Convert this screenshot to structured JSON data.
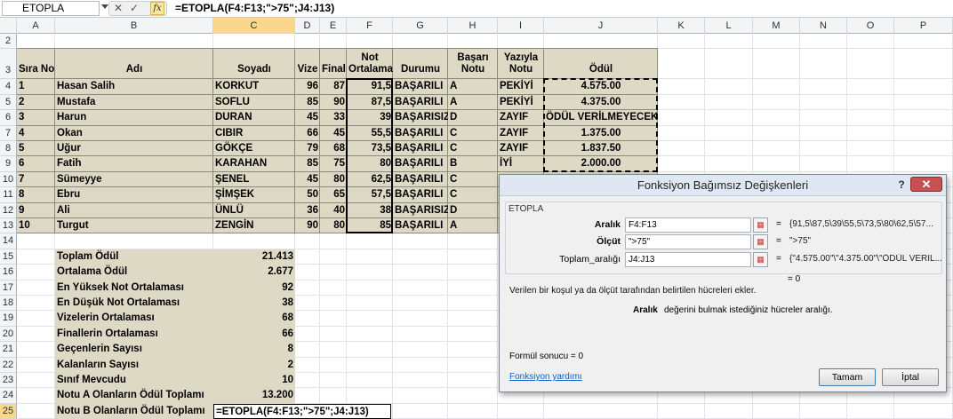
{
  "formula_bar": {
    "name_box": "ETOPLA",
    "cancel_icon": "✕",
    "enter_icon": "✓",
    "fx_label": "fx",
    "formula": "=ETOPLA(F4:F13;\">75\";J4:J13)"
  },
  "columns": [
    "A",
    "B",
    "C",
    "D",
    "E",
    "F",
    "G",
    "H",
    "I",
    "J",
    "K",
    "L",
    "M",
    "N",
    "O",
    "P"
  ],
  "rows": [
    "2",
    "3",
    "4",
    "5",
    "6",
    "7",
    "8",
    "9",
    "10",
    "11",
    "12",
    "13",
    "14",
    "15",
    "16",
    "17",
    "18",
    "19",
    "20",
    "21",
    "22",
    "23",
    "24",
    "25"
  ],
  "header": {
    "sira": "Sıra No",
    "adi": "Adı",
    "soyadi": "Soyadı",
    "vize": "Vize",
    "final": "Final",
    "not1": "Not",
    "not2": "Ortalama",
    "durumu": "Durumu",
    "basari1": "Başarı",
    "basari2": "Notu",
    "yazi1": "Yazıyla",
    "yazi2": "Notu",
    "odul": "Ödül"
  },
  "students": [
    {
      "no": "1",
      "adi": "Hasan Salih",
      "soyadi": "KORKUT",
      "vize": "96",
      "final": "87",
      "ort": "91,5",
      "durum": "BAŞARILI",
      "harf": "A",
      "yazi": "PEKİYİ",
      "odul": "4.575.00"
    },
    {
      "no": "2",
      "adi": "Mustafa",
      "soyadi": "SOFLU",
      "vize": "85",
      "final": "90",
      "ort": "87,5",
      "durum": "BAŞARILI",
      "harf": "A",
      "yazi": "PEKİYİ",
      "odul": "4.375.00"
    },
    {
      "no": "3",
      "adi": "Harun",
      "soyadi": "DURAN",
      "vize": "45",
      "final": "33",
      "ort": "39",
      "durum": "BAŞARISIZ",
      "harf": "D",
      "yazi": "ZAYIF",
      "odul": "ÖDÜL VERİLMEYECEK"
    },
    {
      "no": "4",
      "adi": "Okan",
      "soyadi": "CIBIR",
      "vize": "66",
      "final": "45",
      "ort": "55,5",
      "durum": "BAŞARILI",
      "harf": "C",
      "yazi": "ZAYIF",
      "odul": "1.375.00"
    },
    {
      "no": "5",
      "adi": "Uğur",
      "soyadi": "GÖKÇE",
      "vize": "79",
      "final": "68",
      "ort": "73,5",
      "durum": "BAŞARILI",
      "harf": "C",
      "yazi": "ZAYIF",
      "odul": "1.837.50"
    },
    {
      "no": "6",
      "adi": "Fatih",
      "soyadi": "KARAHAN",
      "vize": "85",
      "final": "75",
      "ort": "80",
      "durum": "BAŞARILI",
      "harf": "B",
      "yazi": "İYİ",
      "odul": "2.000.00"
    },
    {
      "no": "7",
      "adi": "Sümeyye",
      "soyadi": "ŞENEL",
      "vize": "45",
      "final": "80",
      "ort": "62,5",
      "durum": "BAŞARILI",
      "harf": "C",
      "yazi": "",
      "odul": ""
    },
    {
      "no": "8",
      "adi": "Ebru",
      "soyadi": "ŞİMŞEK",
      "vize": "50",
      "final": "65",
      "ort": "57,5",
      "durum": "BAŞARILI",
      "harf": "C",
      "yazi": "",
      "odul": ""
    },
    {
      "no": "9",
      "adi": "Ali",
      "soyadi": "ÜNLÜ",
      "vize": "36",
      "final": "40",
      "ort": "38",
      "durum": "BAŞARISIZ",
      "harf": "D",
      "yazi": "",
      "odul": ""
    },
    {
      "no": "10",
      "adi": "Turgut",
      "soyadi": "ZENGİN",
      "vize": "90",
      "final": "80",
      "ort": "85",
      "durum": "BAŞARILI",
      "harf": "A",
      "yazi": "",
      "odul": ""
    }
  ],
  "summary": [
    {
      "label": "Toplam Ödül",
      "value": "21.413"
    },
    {
      "label": "Ortalama Ödül",
      "value": "2.677"
    },
    {
      "label": "En Yüksek Not Ortalaması",
      "value": "92"
    },
    {
      "label": "En Düşük Not Ortalaması",
      "value": "38"
    },
    {
      "label": "Vizelerin Ortalaması",
      "value": "68"
    },
    {
      "label": "Finallerin Ortalaması",
      "value": "66"
    },
    {
      "label": "Geçenlerin Sayısı",
      "value": "8"
    },
    {
      "label": "Kalanların Sayısı",
      "value": "2"
    },
    {
      "label": "Sınıf Mevcudu",
      "value": "10"
    },
    {
      "label": "Notu A Olanların Ödül Toplamı",
      "value": "13.200"
    },
    {
      "label": "Notu B Olanların Ödül Toplamı",
      "value": "=ETOPLA(F4:F13;\">75\";J4:J13)"
    }
  ],
  "dialog": {
    "title": "Fonksiyon Bağımsız Değişkenleri",
    "help": "?",
    "close": "✕",
    "function_name": "ETOPLA",
    "args": [
      {
        "label": "Aralık",
        "bold": true,
        "value": "F4:F13",
        "result": "{91,5\\87,5\\39\\55,5\\73,5\\80\\62,5\\57..."
      },
      {
        "label": "Ölçüt",
        "bold": true,
        "value": "\">75\"",
        "result": "\">75\""
      },
      {
        "label": "Toplam_aralığı",
        "bold": false,
        "value": "J4:J13",
        "result": "{\"4.575.00\"\\\"4.375.00\"\\\"ÖDÜL VERİL..."
      }
    ],
    "equals": "=",
    "total": "0",
    "description": "Verilen bir koşul ya da ölçüt tarafından belirtilen hücreleri ekler.",
    "arg_desc_name": "Aralık",
    "arg_desc": "değerini bulmak istediğiniz hücreler aralığı.",
    "formula_result": "Formül sonucu =   0",
    "help_link": "Fonksiyon yardımı",
    "ok": "Tamam",
    "cancel": "İptal"
  },
  "colors": {
    "tan": "#ddd9c4",
    "accent": "#3c7fb1"
  }
}
